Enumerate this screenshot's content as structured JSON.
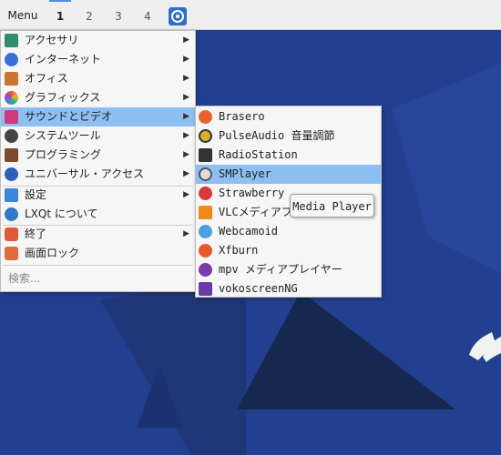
{
  "taskbar": {
    "menu_label": "Menu",
    "desktops": [
      "1",
      "2",
      "3",
      "4"
    ]
  },
  "main_menu": {
    "items": [
      {
        "label": "アクセサリ",
        "icon": "accessories-icon",
        "color": "#2f8d6b"
      },
      {
        "label": "インターネット",
        "icon": "internet-icon",
        "color": "#3a6fd8"
      },
      {
        "label": "オフィス",
        "icon": "office-icon",
        "color": "#c9772e"
      },
      {
        "label": "グラフィックス",
        "icon": "graphics-icon",
        "color": "#e0533a"
      },
      {
        "label": "サウンドとビデオ",
        "icon": "multimedia-icon",
        "color": "#d03a7c"
      },
      {
        "label": "システムツール",
        "icon": "gear-icon",
        "color": "#444444"
      },
      {
        "label": "プログラミング",
        "icon": "hammer-icon",
        "color": "#7a4b2a"
      },
      {
        "label": "ユニバーサル・アクセス",
        "icon": "accessibility-icon",
        "color": "#2e5fb8"
      },
      {
        "label": "設定",
        "icon": "settings-icon",
        "color": "#3a86d8"
      },
      {
        "label": "LXQt について",
        "icon": "lxqt-icon",
        "color": "#3479c6"
      },
      {
        "label": "終了",
        "icon": "power-icon",
        "color": "#e05a3a"
      },
      {
        "label": "画面ロック",
        "icon": "lock-icon",
        "color": "#e06a3a"
      }
    ],
    "search_placeholder": "検索..."
  },
  "sub_menu": {
    "items": [
      {
        "label": "Brasero",
        "icon": "brasero-icon",
        "color": "#e8622f"
      },
      {
        "label": "PulseAudio 音量調節",
        "icon": "pulseaudio-icon",
        "color": "#d8b02a"
      },
      {
        "label": "RadioStation",
        "icon": "radio-icon",
        "color": "#333333"
      },
      {
        "label": "SMPlayer",
        "icon": "smplayer-icon",
        "color": "#555555"
      },
      {
        "label": "Strawberry",
        "icon": "strawberry-icon",
        "color": "#d83a3a"
      },
      {
        "label": "VLCメディアプ",
        "icon": "vlc-icon",
        "color": "#f08a1a"
      },
      {
        "label": "Webcamoid",
        "icon": "webcamoid-icon",
        "color": "#4aa0e0"
      },
      {
        "label": "Xfburn",
        "icon": "xfburn-icon",
        "color": "#e85a2a"
      },
      {
        "label": "mpv メディアプレイヤー",
        "icon": "mpv-icon",
        "color": "#7a3aa8"
      },
      {
        "label": "vokoscreenNG",
        "icon": "vokoscreen-icon",
        "color": "#6a3aa8"
      }
    ]
  },
  "tooltip": "Media Player"
}
